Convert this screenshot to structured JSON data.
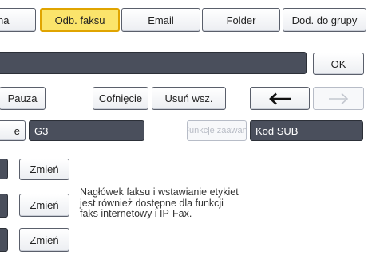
{
  "tabs": [
    {
      "label": "na",
      "selected": false
    },
    {
      "label": "Odb. faksu",
      "selected": true
    },
    {
      "label": "Email",
      "selected": false
    },
    {
      "label": "Folder",
      "selected": false
    },
    {
      "label": "Dod. do grupy",
      "selected": false
    }
  ],
  "entry": {
    "value": "",
    "ok_label": "OK"
  },
  "toolbar": {
    "pause_label": "Pauza",
    "backspace_label": "Cofnięcie",
    "clear_all_label": "Usuń wsz.",
    "left_arrow_icon": "arrow-left-icon",
    "right_arrow_icon": "arrow-right-icon"
  },
  "settings_row": {
    "cut_label": "e",
    "mode_value": "G3",
    "advanced_label": "Funkcje zaawan.",
    "sub_code_label": "Kod SUB"
  },
  "change_buttons": [
    "Zmień",
    "Zmień",
    "Zmień"
  ],
  "note_lines": [
    "Nagłówek faksu i wstawianie etykiet",
    "jest również dostępne dla funkcji",
    "faks internetowy i IP-Fax."
  ],
  "colors": {
    "accent": "#fbe46b",
    "accent_border": "#e0a400",
    "dark_field": "#4a4f5c"
  }
}
